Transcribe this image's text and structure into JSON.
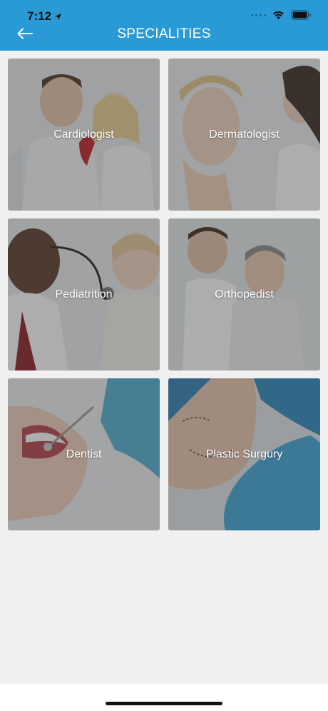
{
  "status_bar": {
    "time": "7:12"
  },
  "header": {
    "title": "SPECIALITIES"
  },
  "specialities": [
    {
      "label": "Cardiologist"
    },
    {
      "label": "Dermatologist"
    },
    {
      "label": "Pediatrition"
    },
    {
      "label": "Orthopedist"
    },
    {
      "label": "Dentist"
    },
    {
      "label": "Plastic Surgury"
    }
  ],
  "colors": {
    "header": "#2a9ad6",
    "background": "#f0f0f0",
    "label": "#ffffff"
  },
  "icons": [
    "location-arrow-icon",
    "wifi-icon",
    "battery-icon",
    "back-arrow-icon"
  ]
}
